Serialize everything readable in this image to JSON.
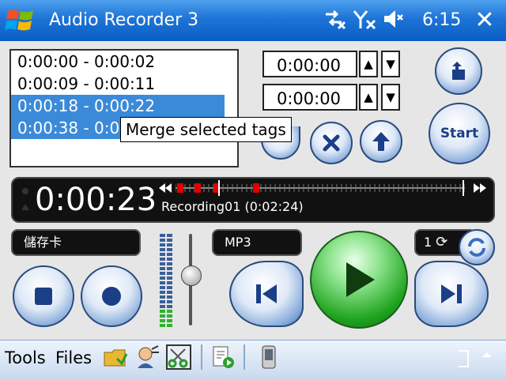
{
  "titlebar": {
    "app_title": "Audio Recorder 3",
    "clock": "6:15",
    "close_label": "✕"
  },
  "tag_list": {
    "items": [
      {
        "label": "0:00:00 - 0:00:02",
        "selected": false
      },
      {
        "label": "0:00:09 - 0:00:11",
        "selected": false
      },
      {
        "label": "0:00:18 - 0:00:22",
        "selected": true
      },
      {
        "label": "0:00:38 - 0:0",
        "selected": true
      }
    ],
    "tooltip": "Merge selected tags"
  },
  "time_inputs": {
    "start": "0:00:00",
    "end": "0:00:00"
  },
  "buttons": {
    "start_label": "Start"
  },
  "display": {
    "elapsed": "0:00:23",
    "filename": "Recording01 (0:02:24)"
  },
  "lower": {
    "storage_label": "儲存卡",
    "format_label": "MP3",
    "loop_count": "1"
  },
  "taskbar": {
    "tools_label": "Tools",
    "files_label": "Files"
  },
  "colors": {
    "titlebar": "#1d74d6",
    "selection": "#3b8ad9",
    "play_green": "#1fa31f",
    "tag_marker_red": "#e00000"
  }
}
